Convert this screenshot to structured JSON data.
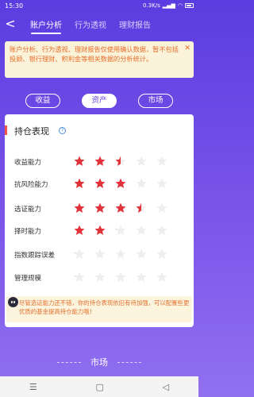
{
  "status": {
    "time": "15:30",
    "speed": "0.3K/s"
  },
  "nav": {
    "tabs": [
      {
        "label": "账户分析",
        "active": true
      },
      {
        "label": "行为透视",
        "active": false
      },
      {
        "label": "理财报告",
        "active": false
      }
    ]
  },
  "notice": {
    "text": "账户分析、行为透视、理财报告仅使用确认数据，暂不包括投顾、银行理财、积利金等相关数据的分析统计。"
  },
  "segments": [
    {
      "label": "收益",
      "active": false
    },
    {
      "label": "资产",
      "active": true
    },
    {
      "label": "市场",
      "active": false
    }
  ],
  "card": {
    "title": "持仓表现",
    "rows": [
      {
        "label": "收益能力",
        "rating": 2.5
      },
      {
        "label": "抗风险能力",
        "rating": 3
      },
      {
        "label": "选证能力",
        "rating": 3.5
      },
      {
        "label": "择时能力",
        "rating": 2.1
      },
      {
        "label": "指数跟踪误差",
        "rating": 0.1
      },
      {
        "label": "管理规模",
        "rating": 0.1
      }
    ],
    "tip": "尽管选证能力还不错，你的持仓表现依旧有待加强，可以配置些更优质的基金提高持仓能力哦！"
  },
  "section": {
    "label": "市场"
  },
  "colors": {
    "star_on": "#e2333a",
    "star_off": "#eeeeee",
    "accent": "#6a45e6"
  }
}
